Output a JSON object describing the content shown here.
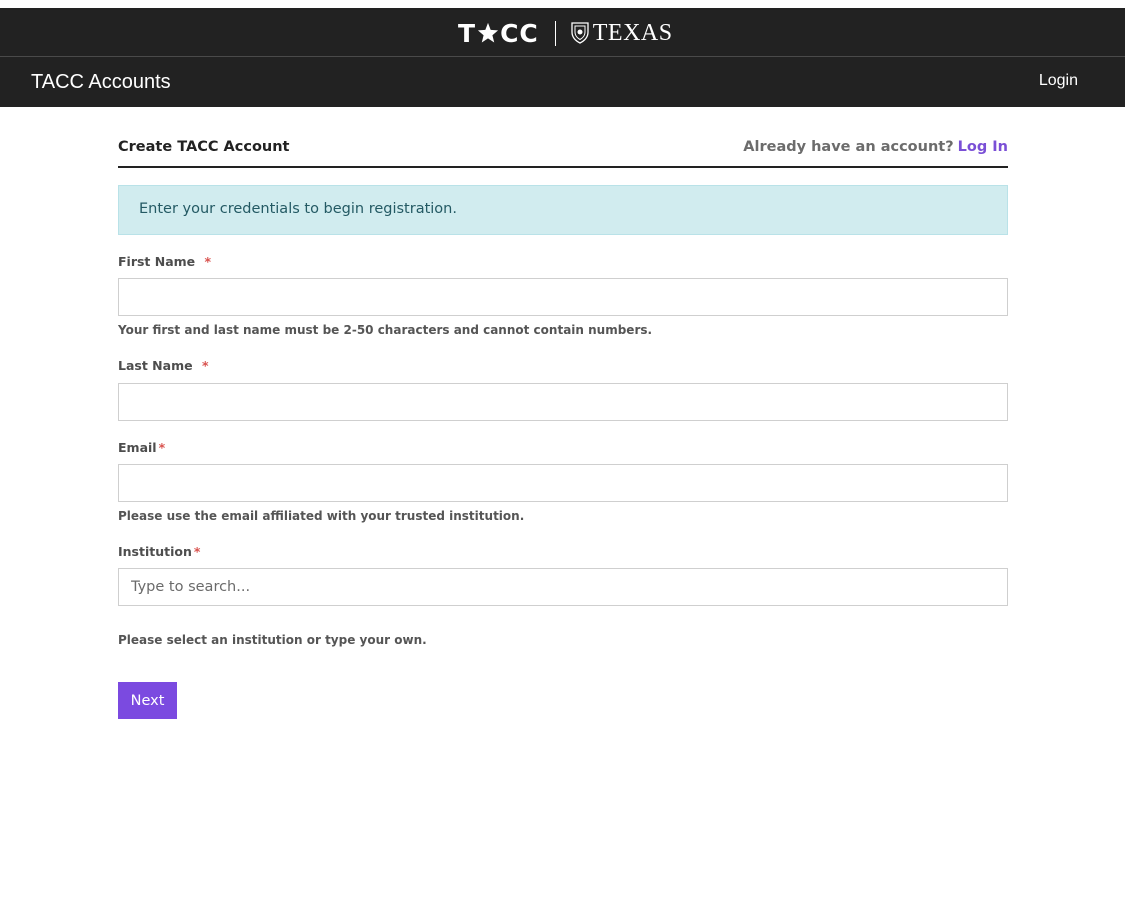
{
  "brand": {
    "tacc_logo_text": "TACC",
    "texas_logo_text": "TEXAS",
    "star_icon": "star-icon",
    "shield_icon": "ut-shield-icon"
  },
  "nav": {
    "title": "TACC Accounts",
    "login_label": "Login"
  },
  "page": {
    "title": "Create TACC Account",
    "already_text": "Already have an account?",
    "login_link": "Log In"
  },
  "alert": {
    "message": "Enter your credentials to begin registration."
  },
  "form": {
    "first_name": {
      "label": "First Name",
      "required_mark": "*",
      "value": "",
      "help": "Your first and last name must be 2-50 characters and cannot contain numbers."
    },
    "last_name": {
      "label": "Last Name",
      "required_mark": "*",
      "value": ""
    },
    "email": {
      "label": "Email",
      "required_mark": "*",
      "value": "",
      "help": "Please use the email affiliated with your trusted institution."
    },
    "institution": {
      "label": "Institution",
      "required_mark": "*",
      "value": "",
      "placeholder": "Type to search...",
      "help": "Please select an institution or type your own."
    },
    "next_label": "Next"
  },
  "colors": {
    "header_bg": "#222222",
    "accent": "#7b4ae0",
    "alert_bg": "#d1ecef",
    "required": "#d9534f"
  }
}
